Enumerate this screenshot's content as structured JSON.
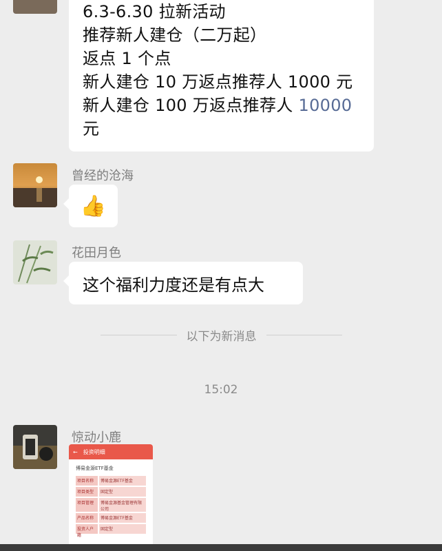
{
  "messages": [
    {
      "lines": [
        "6.3-6.30 拉新活动",
        "推荐新人建仓（二万起）",
        "返点 1 个点",
        "新人建仓 10 万返点推荐人 1000 元",
        "新人建仓 100 万返点推荐人 "
      ],
      "link_number": "10000",
      "tail": "元"
    },
    {
      "sender": "曾经的沧海",
      "content": "👍"
    },
    {
      "sender": "花田月色",
      "content": "这个福利力度还是有点大"
    }
  ],
  "divider_label": "以下为新消息",
  "timestamp": "15:02",
  "last_message": {
    "sender": "惊动小鹿",
    "card": {
      "header": "投资明细",
      "back_arrow": "←",
      "subtitle": "博易金源ETF基金",
      "rows": [
        {
          "k": "项目名称",
          "v": "博易金源ETF基金"
        },
        {
          "k": "项目类型",
          "v": "固定型"
        },
        {
          "k": "项目管理",
          "v": "博易金源基金管理有限公司"
        },
        {
          "k": "产品名称",
          "v": "博易金源ETF基金"
        },
        {
          "k": "投资人户籍",
          "v": "固定型"
        }
      ]
    }
  },
  "colors": {
    "background": "#ededed",
    "bubble": "#ffffff",
    "link": "#576b95",
    "card_header": "#e9584a"
  }
}
